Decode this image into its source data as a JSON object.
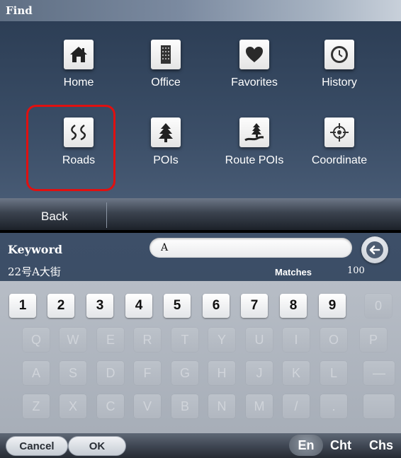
{
  "find_screen": {
    "title": "Find",
    "items": [
      {
        "label": "Home",
        "icon": "home-icon"
      },
      {
        "label": "Office",
        "icon": "office-building-icon"
      },
      {
        "label": "Favorites",
        "icon": "heart-icon"
      },
      {
        "label": "History",
        "icon": "clock-icon"
      },
      {
        "label": "Roads",
        "icon": "roads-icon"
      },
      {
        "label": "POIs",
        "icon": "tree-icon"
      },
      {
        "label": "Route POIs",
        "icon": "route-tree-icon"
      },
      {
        "label": "Coordinate",
        "icon": "crosshair-icon"
      }
    ],
    "highlighted_item": "Roads",
    "highlight_color": "#e01010",
    "back_label": "Back"
  },
  "keyword_screen": {
    "label": "Keyword",
    "input_value": "A",
    "result_text": "22号A大街",
    "matches_label": "Matches",
    "matches_count": "100",
    "keyboard": {
      "row1": [
        "1",
        "2",
        "3",
        "4",
        "5",
        "6",
        "7",
        "8",
        "9",
        "0"
      ],
      "row2": [
        "Q",
        "W",
        "E",
        "R",
        "T",
        "Y",
        "U",
        "I",
        "O",
        "P"
      ],
      "row3": [
        "A",
        "S",
        "D",
        "F",
        "G",
        "H",
        "J",
        "K",
        "L",
        "—"
      ],
      "row4": [
        "Z",
        "X",
        "C",
        "V",
        "B",
        "N",
        "M",
        "/",
        ".",
        ""
      ]
    },
    "cancel_label": "Cancel",
    "ok_label": "OK",
    "languages": [
      "En",
      "Cht",
      "Chs"
    ],
    "active_language": "En"
  }
}
